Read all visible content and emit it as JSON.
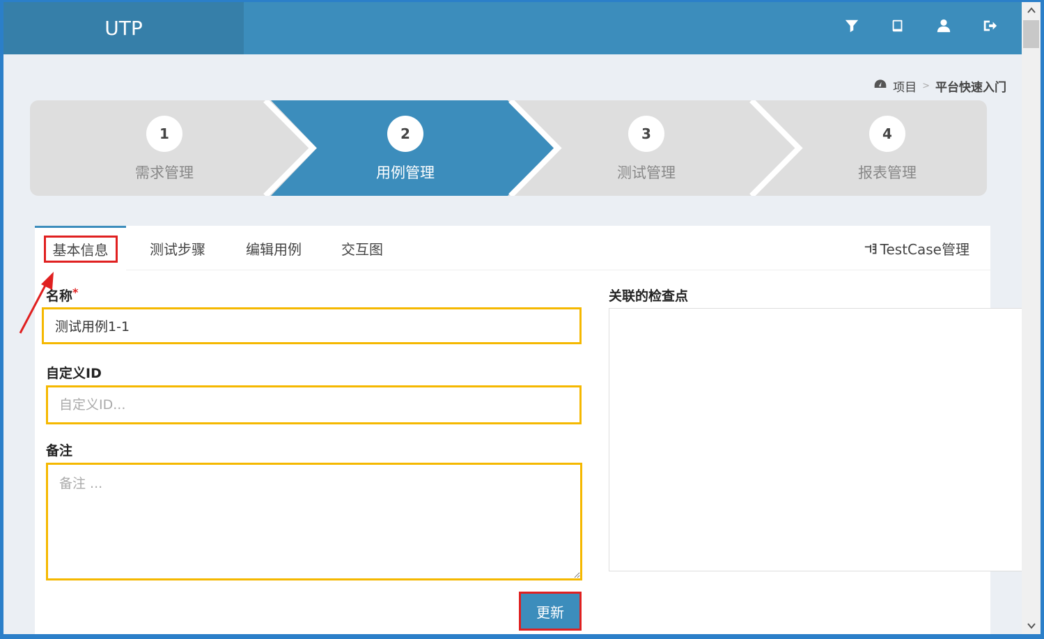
{
  "header": {
    "brand": "UTP",
    "icons": [
      "filter-icon",
      "book-icon",
      "user-icon",
      "logout-icon"
    ]
  },
  "breadcrumb": {
    "icon": "dashboard-icon",
    "root": "项目",
    "separator": ">",
    "current": "平台快速入门"
  },
  "wizard": {
    "steps": [
      {
        "num": "1",
        "label": "需求管理"
      },
      {
        "num": "2",
        "label": "用例管理"
      },
      {
        "num": "3",
        "label": "测试管理"
      },
      {
        "num": "4",
        "label": "报表管理"
      }
    ],
    "active_step": 2,
    "active_color": "#3c8dbc"
  },
  "tabs": {
    "items": [
      "基本信息",
      "测试步骤",
      "编辑用例",
      "交互图"
    ],
    "active": "基本信息",
    "right_link": "TestCase管理"
  },
  "form": {
    "name_label": "名称",
    "required_mark": "*",
    "name_value": "测试用例1-1",
    "custom_id_label": "自定义ID",
    "custom_id_placeholder": "自定义ID...",
    "note_label": "备注",
    "note_placeholder": "备注 ...",
    "checkpoints_label": "关联的检查点",
    "update_button": "更新"
  },
  "colors": {
    "header": "#3c8dbc",
    "brand_bg": "#367fa9",
    "highlight_input": "#f5b800",
    "highlight_annotation": "#e02020"
  }
}
